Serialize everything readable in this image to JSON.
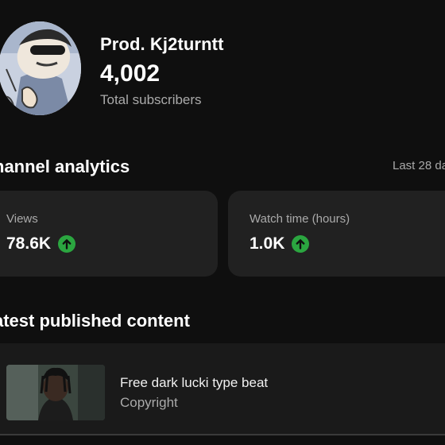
{
  "channel": {
    "name": "Prod. Kj2turntt",
    "subscriber_count": "4,002",
    "subscriber_label": "Total subscribers",
    "avatar_icon": "cartoon-avatar"
  },
  "analytics": {
    "title": "hannel analytics",
    "period": "Last 28 da",
    "cards": [
      {
        "label": "Views",
        "value": "78.6K",
        "trend_icon": "arrow-up-circle-icon",
        "trend_color": "#2ba640"
      },
      {
        "label": "Watch time (hours)",
        "value": "1.0K",
        "trend_icon": "arrow-up-circle-icon",
        "trend_color": "#2ba640"
      }
    ]
  },
  "latest": {
    "title": "atest published content",
    "item": {
      "title": "Free dark lucki type beat",
      "status": "Copyright",
      "thumbnail_icon": "video-thumbnail"
    }
  },
  "colors": {
    "background": "#0f0f0f",
    "card": "#212121",
    "secondary_text": "#aaaaaa",
    "accent_green": "#2ba640"
  }
}
